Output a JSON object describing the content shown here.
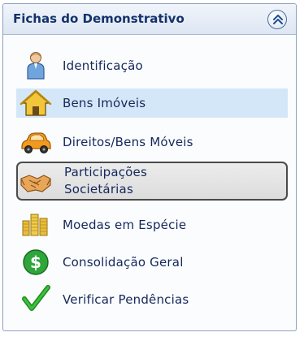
{
  "panel": {
    "title": "Fichas do Demonstrativo",
    "collapse_icon": "double-chevron-up-icon"
  },
  "items": [
    {
      "label": "Identificação",
      "icon": "person-icon",
      "state": "normal"
    },
    {
      "label": "Bens Imóveis",
      "icon": "house-icon",
      "state": "selected"
    },
    {
      "label": "Direitos/Bens Móveis",
      "icon": "car-icon",
      "state": "normal"
    },
    {
      "label_line1": "Participações",
      "label_line2": "Societárias",
      "icon": "handshake-icon",
      "state": "pressed"
    },
    {
      "label": "Moedas em Espécie",
      "icon": "coins-icon",
      "state": "normal"
    },
    {
      "label": "Consolidação Geral",
      "icon": "dollar-icon",
      "state": "normal"
    },
    {
      "label": "Verificar Pendências",
      "icon": "checkmark-icon",
      "state": "normal"
    }
  ],
  "colors": {
    "header_text": "#14326a",
    "item_text": "#15285a",
    "selected_bg": "#d4e7f8",
    "border": "#8da0c0"
  }
}
